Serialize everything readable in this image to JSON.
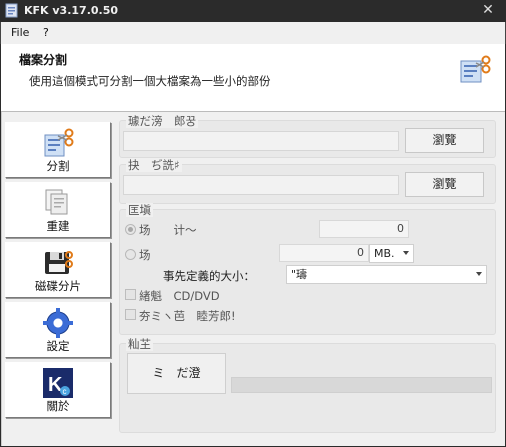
{
  "window": {
    "title": "KFK v3.17.0.50",
    "close_glyph": "✕"
  },
  "menu": {
    "file": "File",
    "help": "?"
  },
  "header": {
    "title": "檔案分割",
    "description": "使用這個模式可分割一個大檔案為一些小的部份"
  },
  "sidebar": {
    "items": [
      {
        "label": "分割",
        "icon": "split-scissors-icon"
      },
      {
        "label": "重建",
        "icon": "rebuild-documents-icon"
      },
      {
        "label": "磁碟分片",
        "icon": "disk-split-icon"
      },
      {
        "label": "設定",
        "icon": "gear-icon"
      },
      {
        "label": "關於",
        "icon": "kfk-logo-icon"
      }
    ]
  },
  "source": {
    "legend": "璩だ滂　郎꿍",
    "value": "",
    "button": "瀏覽"
  },
  "target": {
    "legend": "抉　ぢ詵♯",
    "value": "",
    "button": "瀏覽"
  },
  "options": {
    "legend": "匡塡",
    "by_count_label": "场　　计〜",
    "by_count_value": "0",
    "by_size_label": "场",
    "by_size_value": "0",
    "unit": "MB.",
    "predefined_label": "事先定義的大小：",
    "predefined_value": "\"璹",
    "cd_label": "緖魁　CD/DVD",
    "batch_label": "夯ミヽ芭　睦芳郎!"
  },
  "progress_group": {
    "legend": "籼芏",
    "start_button": "ミ　だ澄",
    "progress": 0
  }
}
